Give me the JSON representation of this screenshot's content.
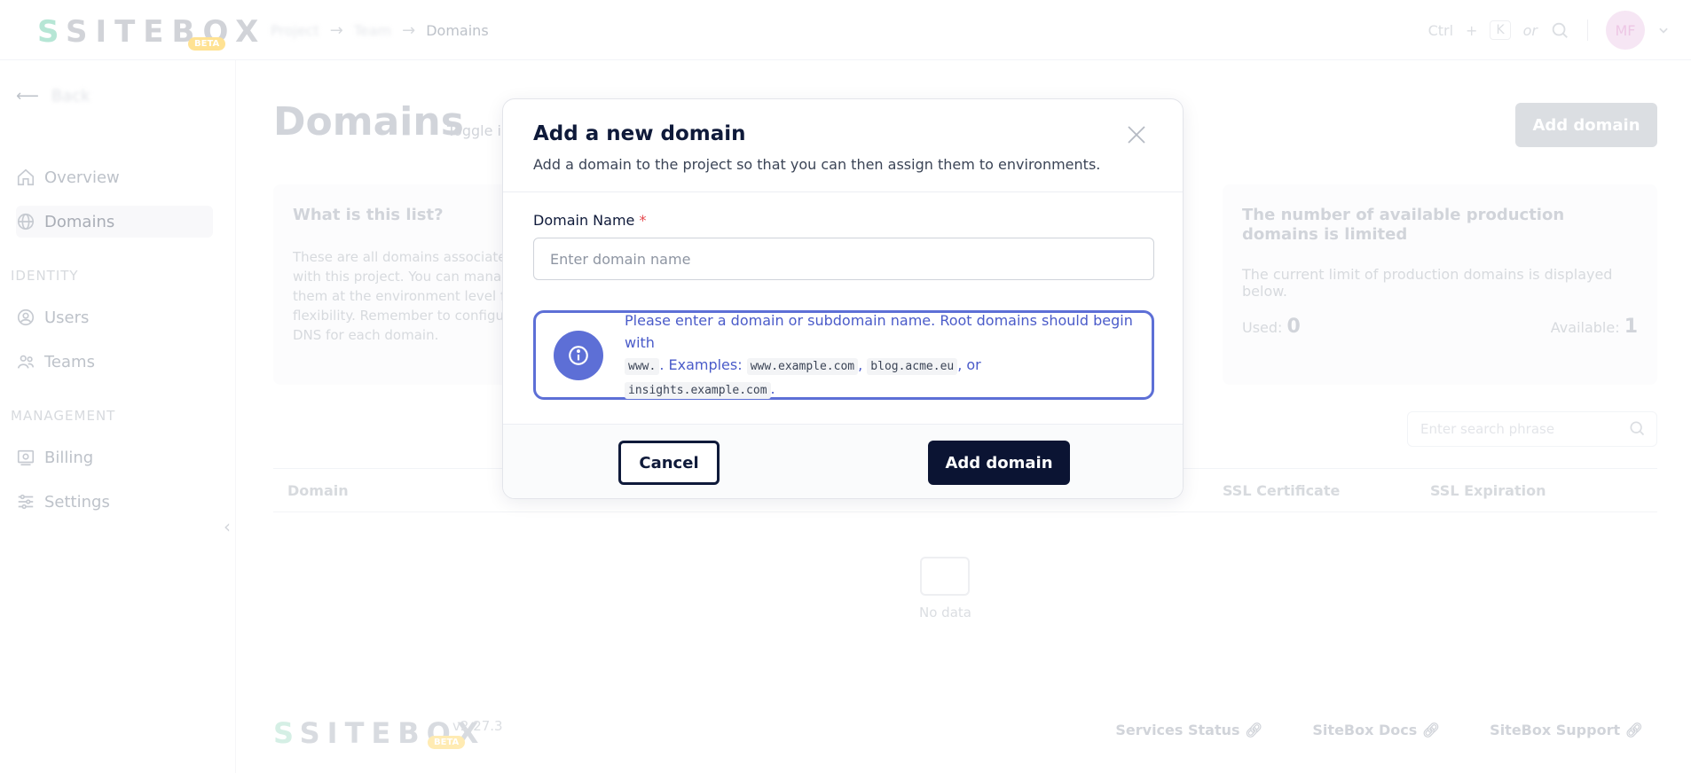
{
  "topbar": {
    "logo_text": "SITEBOX",
    "logo_badge": "BETA",
    "breadcrumb": [
      "Project",
      "Team",
      "Domains"
    ],
    "shortcut_ctrl": "Ctrl",
    "shortcut_plus": "+",
    "shortcut_key": "K",
    "shortcut_or": "or",
    "avatar_initials": "MF"
  },
  "sidebar": {
    "back_label": "Back",
    "items_top": [
      {
        "label": "Overview",
        "icon": "home-icon"
      },
      {
        "label": "Domains",
        "icon": "globe-icon"
      }
    ],
    "section_identity": "IDENTITY",
    "items_identity": [
      {
        "label": "Users",
        "icon": "user-icon"
      },
      {
        "label": "Teams",
        "icon": "team-icon"
      }
    ],
    "section_management": "MANAGEMENT",
    "items_management": [
      {
        "label": "Billing",
        "icon": "billing-icon"
      },
      {
        "label": "Settings",
        "icon": "settings-icon"
      }
    ]
  },
  "main": {
    "title": "Domains",
    "toggle_info": "Toggle info",
    "add_domain_button": "Add domain",
    "info_card": {
      "title": "What is this list?",
      "body": "These are all domains associated with this project. You can manage them at the environment level for flexibility. Remember to configure DNS for each domain."
    },
    "limit_card": {
      "title": "The number of available production domains is limited",
      "body": "The current limit of production domains is displayed below.",
      "used_label": "Used:",
      "used_value": "0",
      "available_label": "Available:",
      "available_value": "1"
    },
    "search_placeholder": "Enter search phrase",
    "table_columns": [
      "Domain",
      "SSL Certificate",
      "SSL Expiration"
    ],
    "no_data": "No data"
  },
  "footer": {
    "logo_text": "SITEBOX",
    "version": "v2.27.3",
    "badge": "BETA",
    "links": [
      "Services Status",
      "SiteBox Docs",
      "SiteBox Support"
    ]
  },
  "modal": {
    "title": "Add a new domain",
    "subtitle": "Add a domain to the project so that you can then assign them to environments.",
    "field_label": "Domain Name",
    "required_mark": "*",
    "input_placeholder": "Enter domain name",
    "input_value": "",
    "info_line1": "Please enter a domain or subdomain name. Root domains should begin with",
    "info_code_www": "www.",
    "info_examples": ". Examples:",
    "info_ex1": "www.example.com",
    "info_ex2": "blog.acme.eu",
    "info_or": ", or",
    "info_ex3": "insights.example.com",
    "info_end": ".",
    "cancel_label": "Cancel",
    "submit_label": "Add domain",
    "accent_color": "#5d6fd6",
    "primary_color": "#0b1433"
  }
}
